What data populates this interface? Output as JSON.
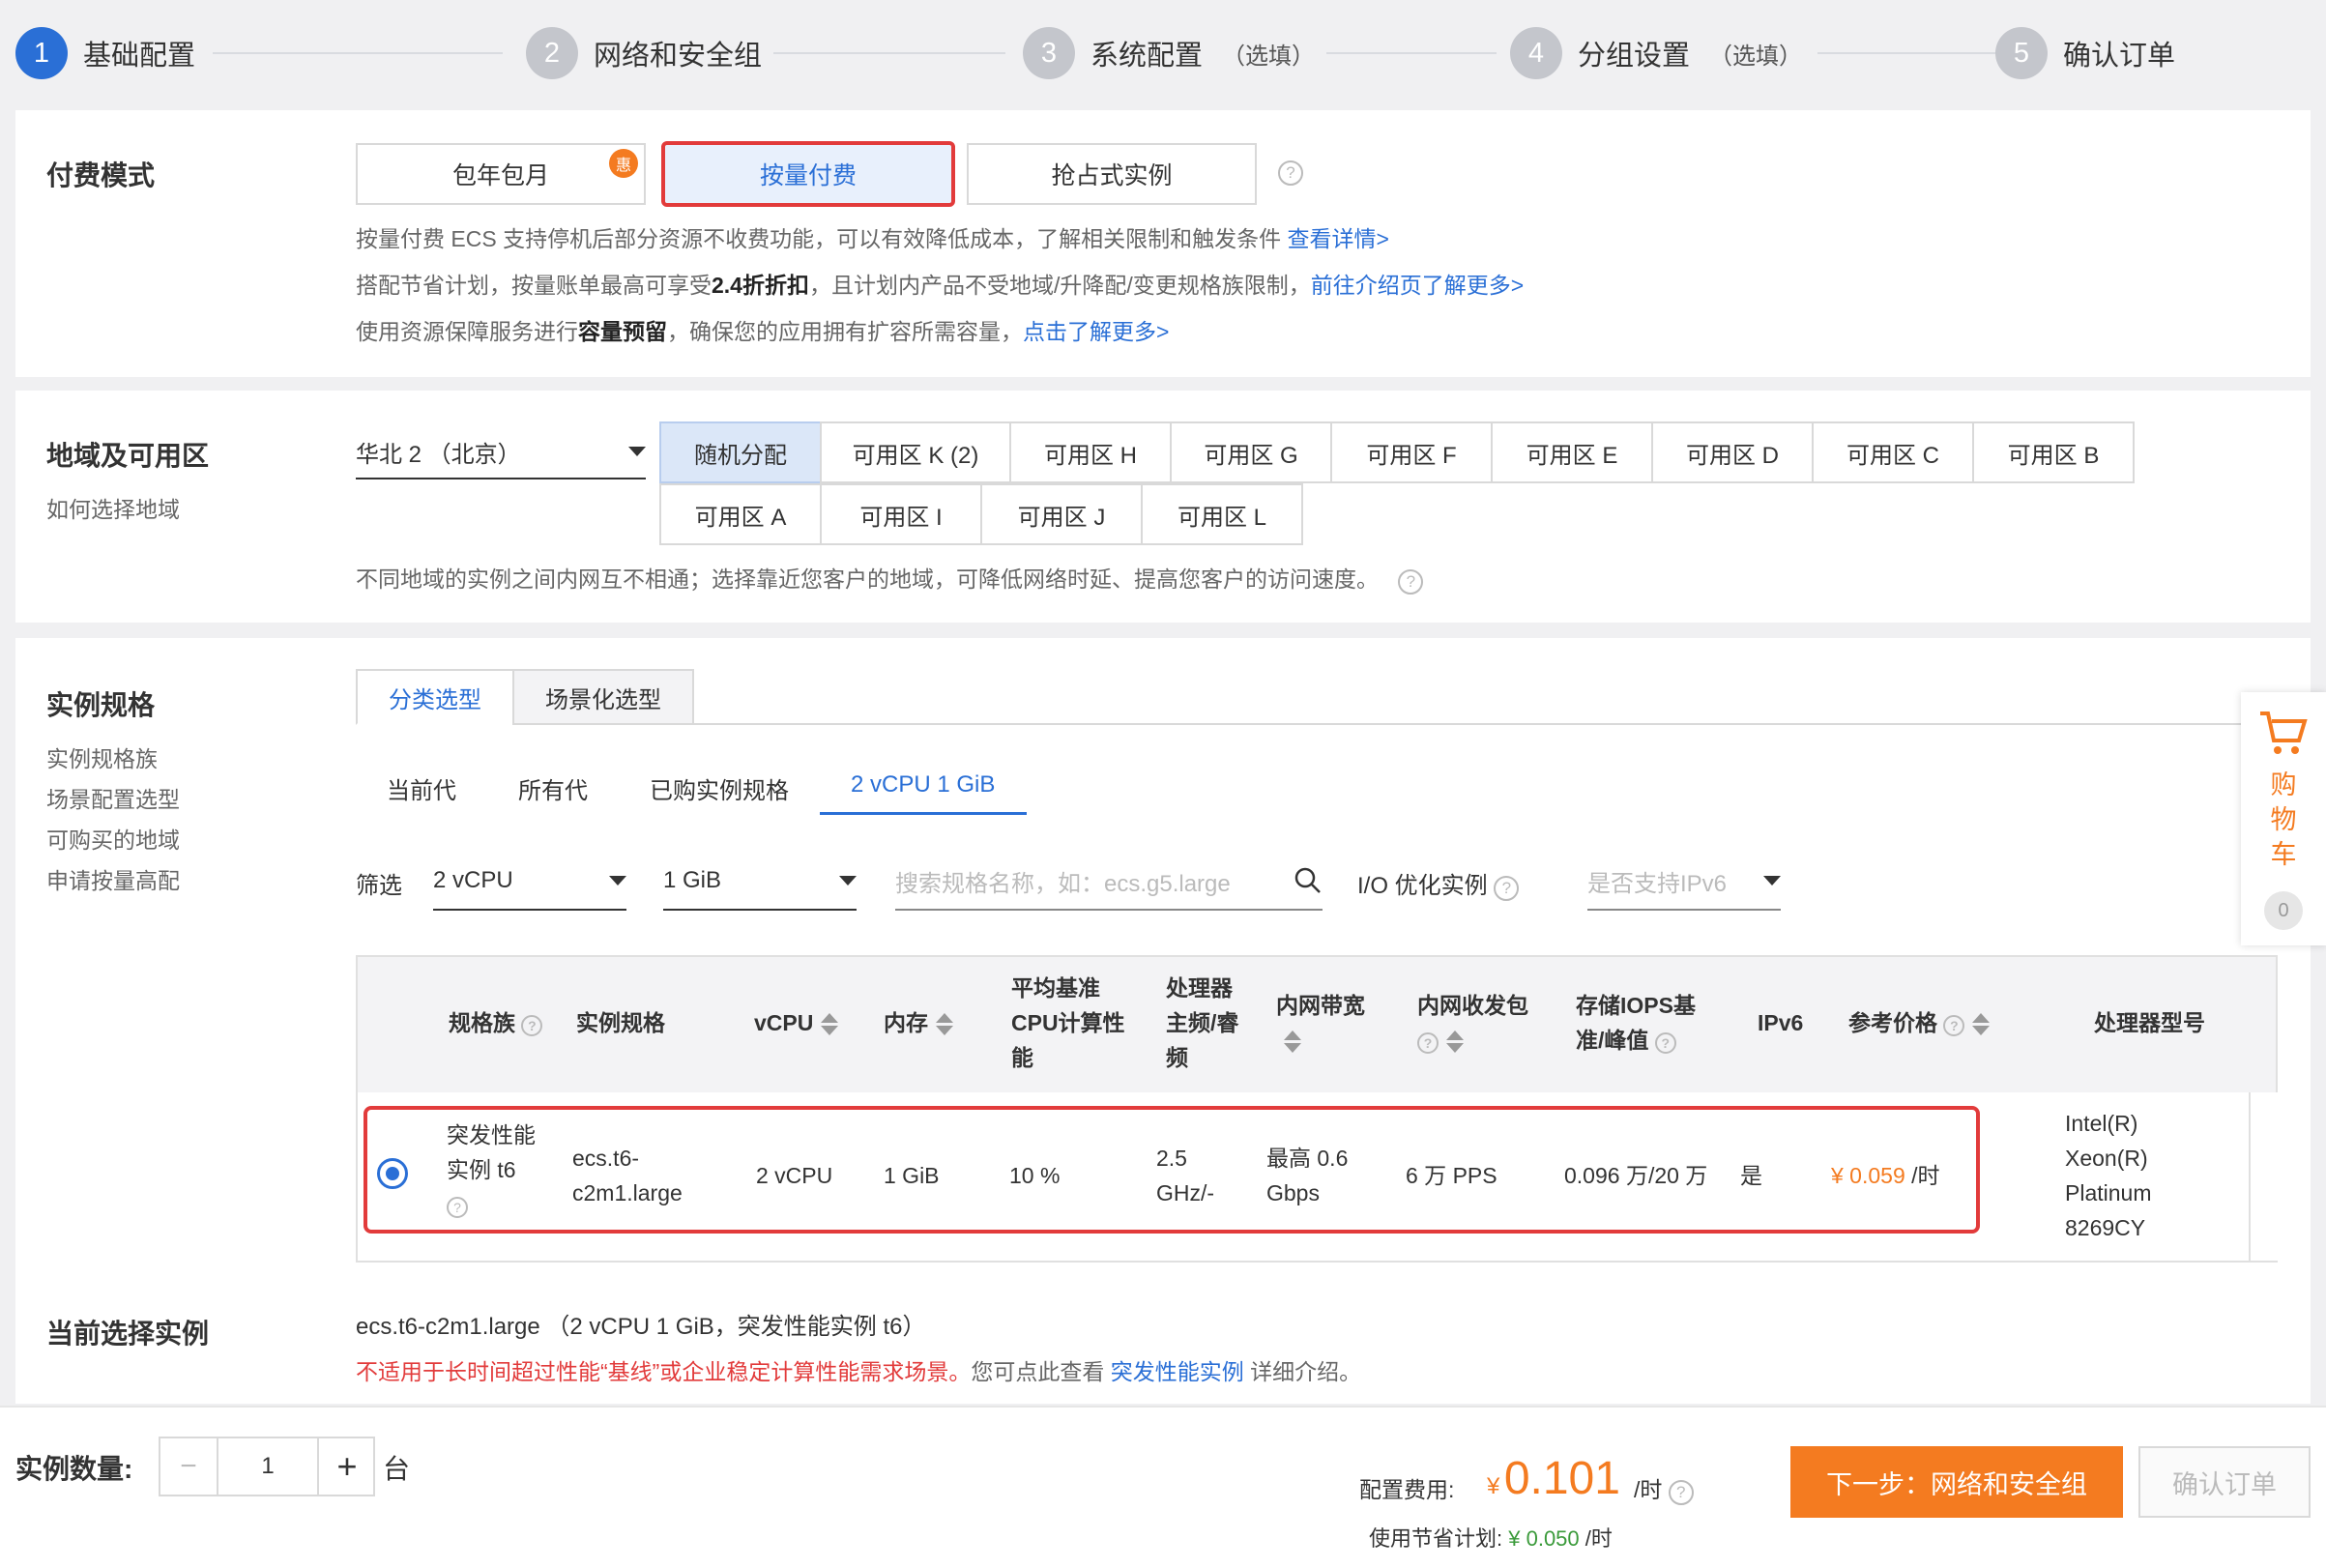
{
  "steps": [
    {
      "num": "1",
      "label": "基础配置",
      "sub": ""
    },
    {
      "num": "2",
      "label": "网络和安全组",
      "sub": ""
    },
    {
      "num": "3",
      "label": "系统配置",
      "sub": "（选填）"
    },
    {
      "num": "4",
      "label": "分组设置",
      "sub": "（选填）"
    },
    {
      "num": "5",
      "label": "确认订单",
      "sub": ""
    }
  ],
  "billing": {
    "title": "付费模式",
    "options": [
      "包年包月",
      "按量付费",
      "抢占式实例"
    ],
    "badge": "惠",
    "line1": "按量付费 ECS 支持停机后部分资源不收费功能，可以有效降低成本，了解相关限制和触发条件",
    "line1_link": "查看详情>",
    "line2_a": "搭配节省计划，按量账单最高可享受",
    "line2_b": "2.4折折扣",
    "line2_c": "，且计划内产品不受地域/升降配/变更规格族限制，",
    "line2_link": "前往介绍页了解更多>",
    "line3_a": "使用资源保障服务进行",
    "line3_b": "容量预留",
    "line3_c": "，确保您的应用拥有扩容所需容量，",
    "line3_link": "点击了解更多>"
  },
  "region": {
    "title": "地域及可用区",
    "help": "如何选择地域",
    "selected": "华北 2 （北京）",
    "zones_row1": [
      "随机分配",
      "可用区 K (2)",
      "可用区 H",
      "可用区 G",
      "可用区 F",
      "可用区 E",
      "可用区 D",
      "可用区 C",
      "可用区 B"
    ],
    "zones_row2": [
      "可用区 A",
      "可用区 I",
      "可用区 J",
      "可用区 L"
    ],
    "note": "不同地域的实例之间内网互不相通；选择靠近您客户的地域，可降低网络时延、提高您客户的访问速度。"
  },
  "instance": {
    "title": "实例规格",
    "side_links": [
      "实例规格族",
      "场景配置选型",
      "可购买的地域",
      "申请按量高配"
    ],
    "tabs": [
      "分类选型",
      "场景化选型"
    ],
    "subtabs": [
      "当前代",
      "所有代",
      "已购实例规格",
      "2 vCPU 1 GiB"
    ],
    "filter_label": "筛选",
    "vcpu": "2 vCPU",
    "mem": "1 GiB",
    "search_placeholder": "搜索规格名称，如：ecs.g5.large",
    "io_label": "I/O 优化实例",
    "ipv6_placeholder": "是否支持IPv6"
  },
  "table": {
    "headers": {
      "family": "规格族",
      "spec": "实例规格",
      "vcpu": "vCPU",
      "mem": "内存",
      "cpu_base": "平均基准CPU计算性能",
      "freq": "处理器主频/睿频",
      "bw": "内网带宽",
      "pps": "内网收发包",
      "iops": "存储IOPS基准/峰值",
      "ipv6": "IPv6",
      "price": "参考价格",
      "cpu_model": "处理器型号"
    },
    "row": {
      "family": "突发性能实例 t6",
      "spec": "ecs.t6-c2m1.large",
      "vcpu": "2 vCPU",
      "mem": "1 GiB",
      "cpu_base": "10 %",
      "freq": "2.5 GHz/-",
      "bw": "最高 0.6 Gbps",
      "pps": "6 万 PPS",
      "iops": "0.096 万/20 万",
      "ipv6": "是",
      "price": "¥ 0.059",
      "price_unit": "/时",
      "cpu_model": "Intel(R) Xeon(R) Platinum 8269CY"
    }
  },
  "current": {
    "title": "当前选择实例",
    "spec": "ecs.t6-c2m1.large （2 vCPU 1 GiB，突发性能实例 t6）",
    "warning": "不适用于长时间超过性能“基线”或企业稳定计算性能需求场景。",
    "info_a": "您可点此查看",
    "info_link": "突发性能实例",
    "info_b": "详细介绍。"
  },
  "footer": {
    "qty_label": "实例数量:",
    "qty": "1",
    "unit": "台",
    "cost_label": "配置费用:",
    "currency": "¥",
    "cost": "0.101",
    "cost_unit": "/时",
    "saving_label": "使用节省计划:",
    "saving": "¥ 0.050",
    "saving_unit": "/时",
    "next_btn": "下一步：网络和安全组",
    "confirm_btn": "确认订单"
  },
  "cart": {
    "label": "购物车",
    "count": "0"
  },
  "colors": {
    "primary": "#2a6fd6",
    "orange": "#f47b20",
    "highlight": "#e23b3b"
  }
}
